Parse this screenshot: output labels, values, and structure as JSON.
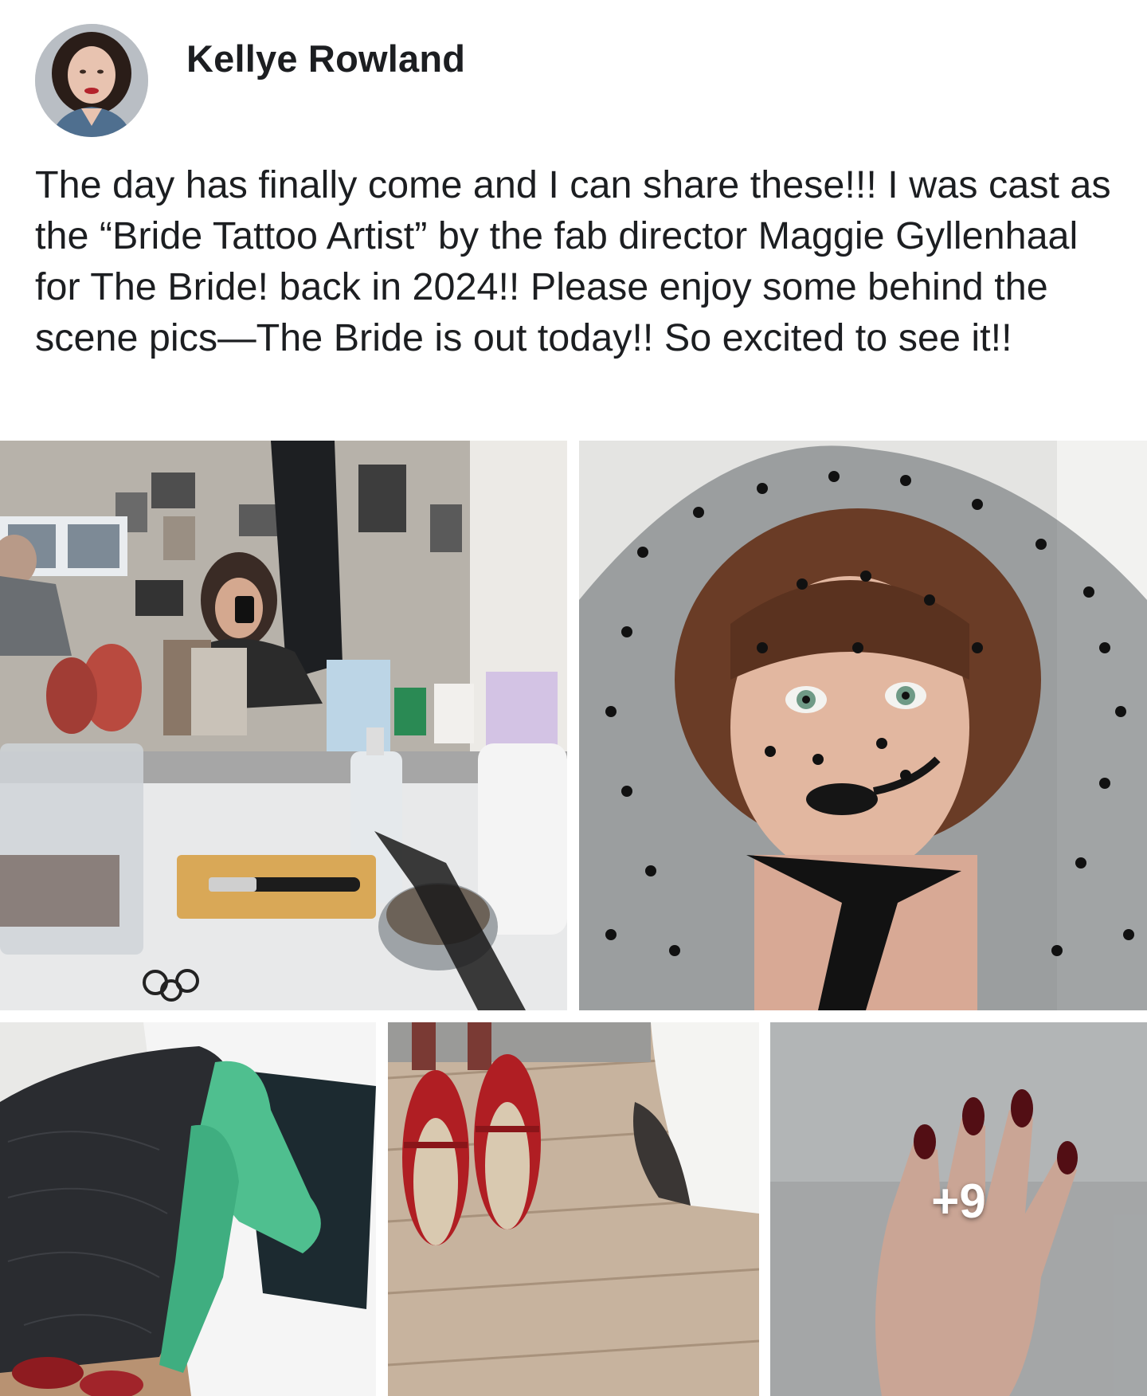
{
  "post": {
    "author": {
      "name": "Kellye Rowland"
    },
    "text": "The day has finally come and I can share these!!! I was cast as the “Bride Tattoo Artist” by the fab director Maggie Gyllenhaal for The Bride! back in 2024!! Please enjoy some behind the scene pics—The Bride is out today!! So excited to see it!!",
    "photos": {
      "more_count_label": "+9"
    }
  }
}
